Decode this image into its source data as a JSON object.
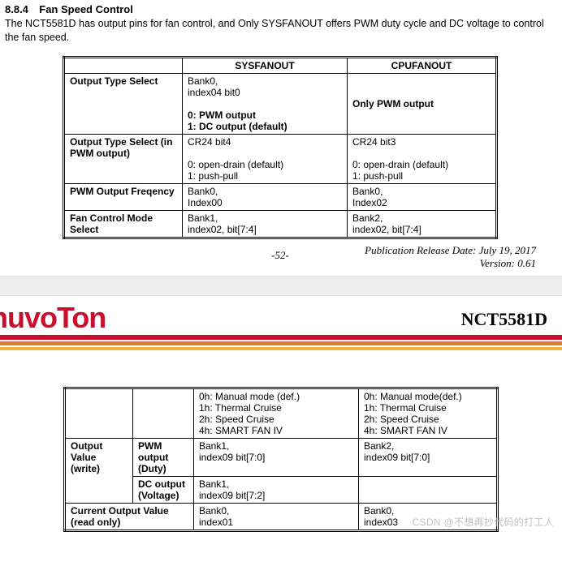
{
  "section": {
    "number": "8.8.4",
    "title": "Fan Speed Control",
    "body": "The NCT5581D has output pins for fan control, and Only SYSFANOUT offers PWM duty cycle and DC voltage to control the fan speed."
  },
  "table1": {
    "headers": {
      "c0": "",
      "c1": "SYSFANOUT",
      "c2": "CPUFANOUT"
    },
    "rows": [
      {
        "label": "Output Type Select",
        "sys_l1": "Bank0,",
        "sys_l2": "index04 bit0",
        "sys_l3": "",
        "sys_l4": "0: PWM output",
        "sys_l5": "1: DC output (default)",
        "cpu_l1": "",
        "cpu_l2": "",
        "cpu_l3": "Only PWM output"
      },
      {
        "label": "Output Type Select (in PWM output)",
        "sys_l1": "CR24 bit4",
        "sys_l2": "",
        "sys_l3": "0: open-drain (default)",
        "sys_l4": "1: push-pull",
        "cpu_l1": "CR24 bit3",
        "cpu_l2": "",
        "cpu_l3": "0: open-drain (default)",
        "cpu_l4": "1: push-pull"
      },
      {
        "label": "PWM Output Freqency",
        "sys_l1": "Bank0,",
        "sys_l2": "Index00",
        "cpu_l1": "Bank0,",
        "cpu_l2": "Index02"
      },
      {
        "label": "Fan Control Mode Select",
        "sys_l1": "Bank1,",
        "sys_l2": "index02, bit[7:4]",
        "cpu_l1": "Bank2,",
        "cpu_l2": "index02, bit[7:4]"
      }
    ]
  },
  "footer": {
    "page": "-52-",
    "pubdate": "Publication Release Date: July 19, 2017",
    "version": "Version: 0.61"
  },
  "header2": {
    "logo_text": "nuvoTon",
    "chip": "NCT5581D",
    "colors": {
      "brand": "#c8102e",
      "stripe2": "#e07a2e",
      "stripe3": "#f0b63a"
    }
  },
  "table2": {
    "row0": {
      "sys_l1": "0h: Manual mode (def.)",
      "sys_l2": "1h: Thermal Cruise",
      "sys_l3": "2h: Speed Cruise",
      "sys_l4": "4h: SMART FAN IV",
      "cpu_l1": "0h: Manual mode(def.)",
      "cpu_l2": "1h: Thermal Cruise",
      "cpu_l3": "2h: Speed Cruise",
      "cpu_l4": "4h: SMART FAN IV"
    },
    "row1": {
      "label_a": "Output Value (write)",
      "label_b": "PWM output (Duty)",
      "sys_l1": "Bank1,",
      "sys_l2": "index09 bit[7:0]",
      "cpu_l1": "Bank2,",
      "cpu_l2": "index09 bit[7:0]"
    },
    "row2": {
      "label_b": "DC output (Voltage)",
      "sys_l1": "Bank1,",
      "sys_l2": "index09 bit[7:2]"
    },
    "row3": {
      "label": "Current Output Value (read only)",
      "sys_l1": "Bank0,",
      "sys_l2": "index01",
      "cpu_l1": "Bank0,",
      "cpu_l2": "index03"
    }
  },
  "watermark": "CSDN @不想再抄代码的打工人"
}
